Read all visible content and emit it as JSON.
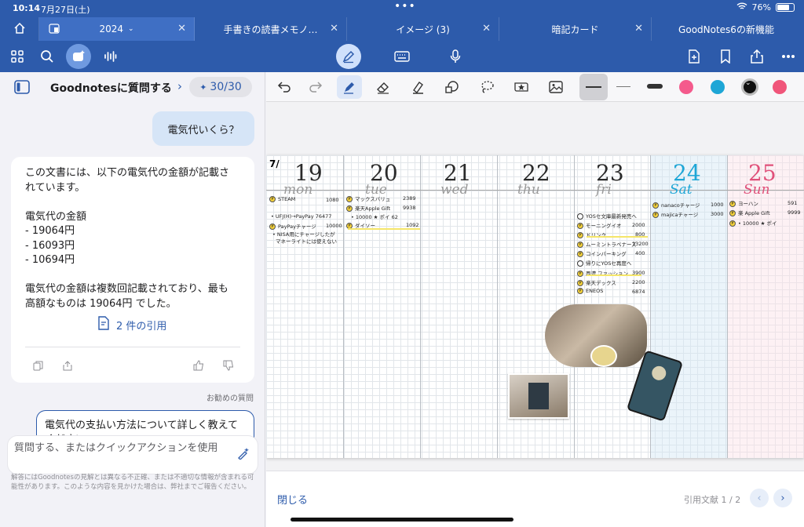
{
  "status": {
    "time": "10:14",
    "date": "7月27日(土)",
    "battery": "76%",
    "battery_level": 0.76
  },
  "tabs": [
    {
      "label": "2024",
      "active": true
    },
    {
      "label": "手書きの読書メモノ…"
    },
    {
      "label": "イメージ (3)"
    },
    {
      "label": "暗記カード"
    },
    {
      "label": "GoodNotes6の新機能"
    }
  ],
  "icons": {
    "home": "home-icon",
    "grid": "grid-icon",
    "search": "search-icon",
    "ai": "ai-assistant-icon",
    "voice": "voice-icon",
    "pencil": "pencil-icon",
    "keyboard": "keyboard-icon",
    "mic": "mic-icon",
    "add_page": "add-page-icon",
    "bookmark": "bookmark-icon",
    "share": "share-icon",
    "more": "more-icon"
  },
  "assistant": {
    "title": "Goodnotesに質問する",
    "credits": "30/30",
    "question": "電気代いくら？",
    "answer_lines": [
      "この文書には、以下の電気代の金額が記載さ",
      "れています。",
      "",
      "電気代の金額",
      "- 19064円",
      "- 16093円",
      "- 10694円",
      "",
      "電気代の金額は複数回記載されており、最も",
      "高額なものは 19064円 でした。"
    ],
    "citations": "2 件の引用",
    "suggest_label": "お勧めの質問",
    "suggest_text": "電気代の支払い方法について詳しく教えてください",
    "input_placeholder": "質問する、またはクイックアクションを使用",
    "disclaimer": "解答にはGoodnotesの見解とは異なる不正確、または不適切な情報が含まれる可能性があります。このような内容を見かけた場合は、弊社までご報告ください。"
  },
  "colors": {
    "brand": "#2d5bab",
    "dots": [
      "#f45a8c",
      "#1ea6d6",
      "#111111",
      "#f0557a"
    ]
  },
  "planner": {
    "month_mark": "7/",
    "days": [
      {
        "num": "19",
        "name": "mon"
      },
      {
        "num": "20",
        "name": "tue"
      },
      {
        "num": "21",
        "name": "wed"
      },
      {
        "num": "22",
        "name": "thu"
      },
      {
        "num": "23",
        "name": "fri"
      },
      {
        "num": "24",
        "name": "Sat"
      },
      {
        "num": "25",
        "name": "Sun"
      }
    ],
    "mon": [
      {
        "t": "STEAM",
        "a": "1080"
      },
      {
        "t": "• UFJ(H)→PayPay 76477",
        "a": ""
      },
      {
        "t": "PayPayチャージ",
        "a": "10000"
      },
      {
        "t": "• NISA用にチャージしたが",
        "a": ""
      },
      {
        "t": "マネーライトには使えない",
        "a": ""
      }
    ],
    "tue": [
      {
        "t": "マックスバリュ",
        "a": "2389"
      },
      {
        "t": "楽天Apple Gift",
        "a": "9938"
      },
      {
        "t": "• 10000 ★ ポイ 62",
        "a": ""
      },
      {
        "t": "ダイソー",
        "a": "1092"
      }
    ],
    "fri": [
      {
        "t": "YOSセ文庫最新発売へ",
        "a": ""
      },
      {
        "t": "モーニングイオ",
        "a": "2000"
      },
      {
        "t": "ドリンク",
        "a": "800"
      },
      {
        "t": "ムーミントラベナーズ",
        "a": "13200"
      },
      {
        "t": "コインパーキング",
        "a": "400"
      },
      {
        "t": "帰りにYOSセ再度へ",
        "a": ""
      },
      {
        "t": "西濃 ファッション",
        "a": "3900"
      },
      {
        "t": "楽天デックス",
        "a": "2200"
      },
      {
        "t": "ENEOS",
        "a": "6874"
      }
    ],
    "sat": [
      {
        "t": "nanacoチャージ",
        "a": "1000"
      },
      {
        "t": "majicaチャージ",
        "a": "3000"
      }
    ],
    "sun": [
      {
        "t": "ヨーハン",
        "a": "591"
      },
      {
        "t": "楽 Apple Gift",
        "a": "9999"
      },
      {
        "t": "• 10000 ★ ポイ",
        "a": ""
      }
    ]
  },
  "bottom": {
    "close": "閉じる",
    "cite_count": "引用文献 1 / 2"
  }
}
